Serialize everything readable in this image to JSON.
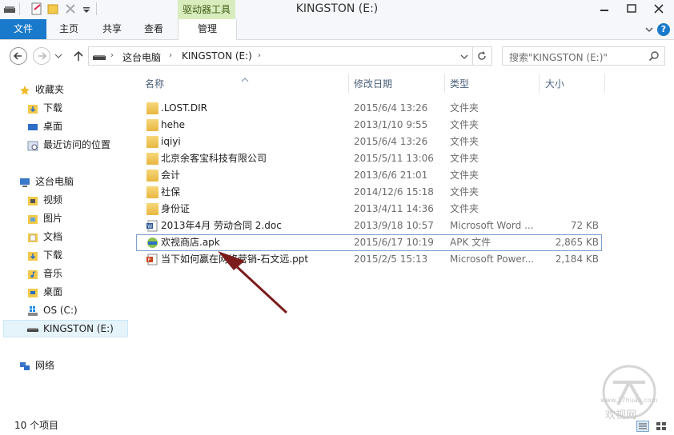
{
  "window": {
    "title": "KINGSTON (E:)",
    "context_tab": "驱动器工具"
  },
  "ribbon": {
    "tabs": [
      {
        "label": "文件"
      },
      {
        "label": "主页"
      },
      {
        "label": "共享"
      },
      {
        "label": "查看"
      },
      {
        "label": "管理"
      }
    ]
  },
  "address": {
    "crumbs": [
      "这台电脑",
      "KINGSTON (E:)"
    ],
    "search_placeholder": "搜索\"KINGSTON (E:)\""
  },
  "nav": {
    "items": [
      {
        "label": "收藏夹",
        "icon": "star-icon",
        "level": 0
      },
      {
        "label": "下载",
        "icon": "downloads-folder-icon",
        "level": 1
      },
      {
        "label": "桌面",
        "icon": "desktop-icon",
        "level": 1
      },
      {
        "label": "最近访问的位置",
        "icon": "recent-places-icon",
        "level": 1
      },
      {
        "label": "这台电脑",
        "icon": "computer-icon",
        "level": 0
      },
      {
        "label": "视频",
        "icon": "videos-folder-icon",
        "level": 1
      },
      {
        "label": "图片",
        "icon": "pictures-folder-icon",
        "level": 1
      },
      {
        "label": "文档",
        "icon": "documents-folder-icon",
        "level": 1
      },
      {
        "label": "下载",
        "icon": "downloads-folder-icon",
        "level": 1
      },
      {
        "label": "音乐",
        "icon": "music-folder-icon",
        "level": 1
      },
      {
        "label": "桌面",
        "icon": "desktop-folder-icon",
        "level": 1
      },
      {
        "label": "OS (C:)",
        "icon": "windows-drive-icon",
        "level": 1
      },
      {
        "label": "KINGSTON (E:)",
        "icon": "usb-drive-icon",
        "level": 1,
        "selected": true
      },
      {
        "label": "网络",
        "icon": "network-icon",
        "level": 0
      }
    ]
  },
  "files": {
    "columns": [
      "名称",
      "修改日期",
      "类型",
      "大小"
    ],
    "rows": [
      {
        "name": ".LOST.DIR",
        "date": "2015/6/4 13:26",
        "type": "文件夹",
        "size": "",
        "icon": "folder-icon"
      },
      {
        "name": "hehe",
        "date": "2013/1/10 9:55",
        "type": "文件夹",
        "size": "",
        "icon": "folder-icon"
      },
      {
        "name": "iqiyi",
        "date": "2015/6/4 13:26",
        "type": "文件夹",
        "size": "",
        "icon": "folder-icon"
      },
      {
        "name": "北京余客宝科技有限公司",
        "date": "2015/5/11 13:06",
        "type": "文件夹",
        "size": "",
        "icon": "folder-icon"
      },
      {
        "name": "会计",
        "date": "2013/6/6 21:01",
        "type": "文件夹",
        "size": "",
        "icon": "folder-icon"
      },
      {
        "name": "社保",
        "date": "2014/12/6 15:18",
        "type": "文件夹",
        "size": "",
        "icon": "folder-icon"
      },
      {
        "name": "身份证",
        "date": "2013/4/11 14:36",
        "type": "文件夹",
        "size": "",
        "icon": "folder-icon"
      },
      {
        "name": "2013年4月 劳动合同 2.doc",
        "date": "2013/9/18 10:57",
        "type": "Microsoft Word ...",
        "size": "72 KB",
        "icon": "word-doc-icon"
      },
      {
        "name": "欢视商店.apk",
        "date": "2015/6/17 10:19",
        "type": "APK 文件",
        "size": "2,865 KB",
        "icon": "apk-icon",
        "highlighted": true
      },
      {
        "name": "当下如何赢在网络营销-石文远.ppt",
        "date": "2015/2/5 15:13",
        "type": "Microsoft Power...",
        "size": "2,184 KB",
        "icon": "ppt-icon"
      }
    ]
  },
  "status": {
    "count": "10 个项目"
  },
  "watermark": {
    "text": "欢视网",
    "url": "www.17huan.com"
  },
  "colors": {
    "file_tab": "#1979ca",
    "context_tab": "#d9ecbd",
    "selection": "#e5f3fb",
    "arrow": "#7a1c1c"
  }
}
